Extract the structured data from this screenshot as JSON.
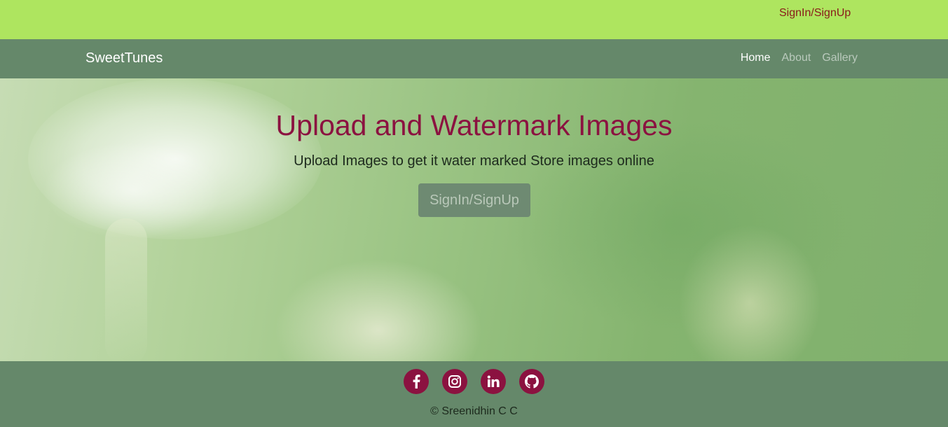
{
  "topbar": {
    "signin_link": "SignIn/SignUp",
    "bg": "#aee55f"
  },
  "navbar": {
    "brand": "SweetTunes",
    "items": [
      {
        "label": "Home",
        "active": true
      },
      {
        "label": "About",
        "active": false
      },
      {
        "label": "Gallery",
        "active": false
      }
    ],
    "bg": "#65886a"
  },
  "hero": {
    "title": "Upload and Watermark Images",
    "subtitle": "Upload Images to get it water marked Store images online",
    "cta": "SignIn/SignUp",
    "title_color": "#8b1240"
  },
  "footer": {
    "social": [
      {
        "icon": "facebook-icon"
      },
      {
        "icon": "instagram-icon"
      },
      {
        "icon": "linkedin-icon"
      },
      {
        "icon": "github-icon"
      }
    ],
    "copyright": "© Sreenidhin C C",
    "accent": "#8b1240"
  }
}
